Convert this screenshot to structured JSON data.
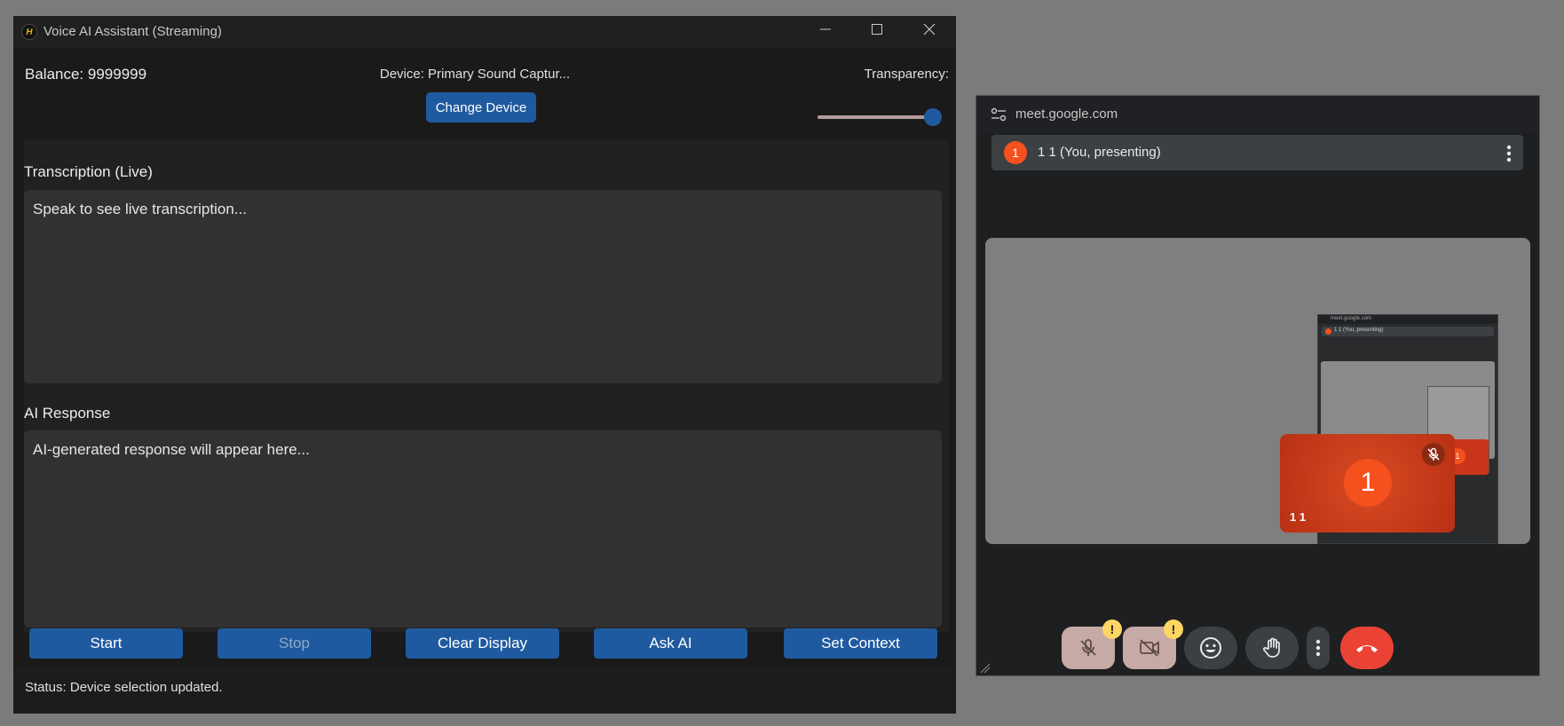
{
  "voice_app": {
    "window_title": "Voice AI Assistant (Streaming)",
    "logo_letter": "H",
    "window_controls": {
      "minimize": "—",
      "maximize": "☐",
      "close": "✕"
    },
    "balance": "Balance: 9999999",
    "device": "Device: Primary Sound Captur...",
    "change_device_label": "Change Device",
    "transparency_label": "Transparency:",
    "transparency_level": 1.0,
    "transcription_heading": "Transcription (Live)",
    "transcription_placeholder": "Speak to see live transcription...",
    "ai_response_heading": "AI Response",
    "ai_response_placeholder": "AI-generated response will appear here...",
    "buttons": {
      "start": "Start",
      "stop": "Stop",
      "clear_display": "Clear Display",
      "ask_ai": "Ask AI",
      "set_context": "Set Context"
    },
    "status": "Status: Device selection updated.",
    "accent_color": "#1f5aa0"
  },
  "meet": {
    "url": "meet.google.com",
    "presenter_initial": "1",
    "presenter_label": "1 1 (You, presenting)",
    "self_initial": "1",
    "self_name": "1 1",
    "warning_badge": "!",
    "icons": [
      "tune-icon",
      "mic-off-icon",
      "camera-off-icon",
      "emoji-icon",
      "raise-hand-icon",
      "more-vert-icon",
      "end-call-icon"
    ],
    "end_call_color": "#ea4335",
    "avatar_color": "#f4511e"
  }
}
